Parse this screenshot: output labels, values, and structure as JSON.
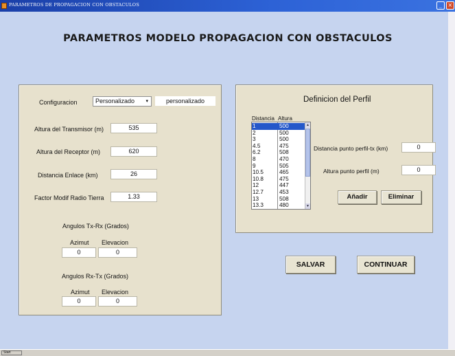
{
  "window": {
    "title": "PARAMETROS DE PROPAGACION CON OBSTACULOS",
    "minimize_glyph": "_",
    "close_glyph": "×"
  },
  "header": {
    "title": "PARAMETROS MODELO PROPAGACION CON OBSTACULOS"
  },
  "left_panel": {
    "config_label": "Configuracion",
    "config_select_value": "Personalizado",
    "config_select_arrow": "▾",
    "config_text": "personalizado",
    "tx_height_label": "Altura del Transmisor (m)",
    "tx_height_value": "535",
    "rx_height_label": "Altura del Receptor (m)",
    "rx_height_value": "620",
    "distance_label": "Distancia Enlace (km)",
    "distance_value": "26",
    "factor_label": "Factor Modif Radio Tierra",
    "factor_value": "1.33",
    "txrx_title": "Angulos Tx-Rx (Grados)",
    "txrx_azimut_label": "Azimut",
    "txrx_elev_label": "Elevacion",
    "txrx_azimut_value": "0",
    "txrx_elev_value": "0",
    "rxtx_title": "Angulos Rx-Tx (Grados)",
    "rxtx_azimut_label": "Azimut",
    "rxtx_elev_label": "Elevacion",
    "rxtx_azimut_value": "0",
    "rxtx_elev_value": "0"
  },
  "profile_panel": {
    "title": "Definicion del Perfil",
    "col_distance": "Distancia",
    "col_height": "Altura",
    "rows": [
      {
        "distancia": "1",
        "altura": "500",
        "selected": true
      },
      {
        "distancia": "2",
        "altura": "500"
      },
      {
        "distancia": "3",
        "altura": "500"
      },
      {
        "distancia": "4.5",
        "altura": "475"
      },
      {
        "distancia": "6.2",
        "altura": "508"
      },
      {
        "distancia": "8",
        "altura": "470"
      },
      {
        "distancia": "9",
        "altura": "505"
      },
      {
        "distancia": "10.5",
        "altura": "465"
      },
      {
        "distancia": "10.8",
        "altura": "475"
      },
      {
        "distancia": "12",
        "altura": "447"
      },
      {
        "distancia": "12.7",
        "altura": "453"
      },
      {
        "distancia": "13",
        "altura": "508"
      },
      {
        "distancia": "13.3",
        "altura": "480"
      }
    ],
    "point_distance_label": "Distancia punto perfil-tx (km)",
    "point_distance_value": "0",
    "point_height_label": "Altura punto perfil (m)",
    "point_height_value": "0",
    "add_button": "Añadir",
    "remove_button": "Eliminar",
    "scroll_up": "▲",
    "scroll_down": "▼"
  },
  "actions": {
    "save_button": "SALVAR",
    "continue_button": "CONTINUAR"
  },
  "taskbar": {
    "start_label": "Start"
  },
  "colors": {
    "background": "#c6d4ef",
    "panel": "#e7e1cd",
    "title_bar": "#2d62d6",
    "list_selection": "#2457c9"
  }
}
